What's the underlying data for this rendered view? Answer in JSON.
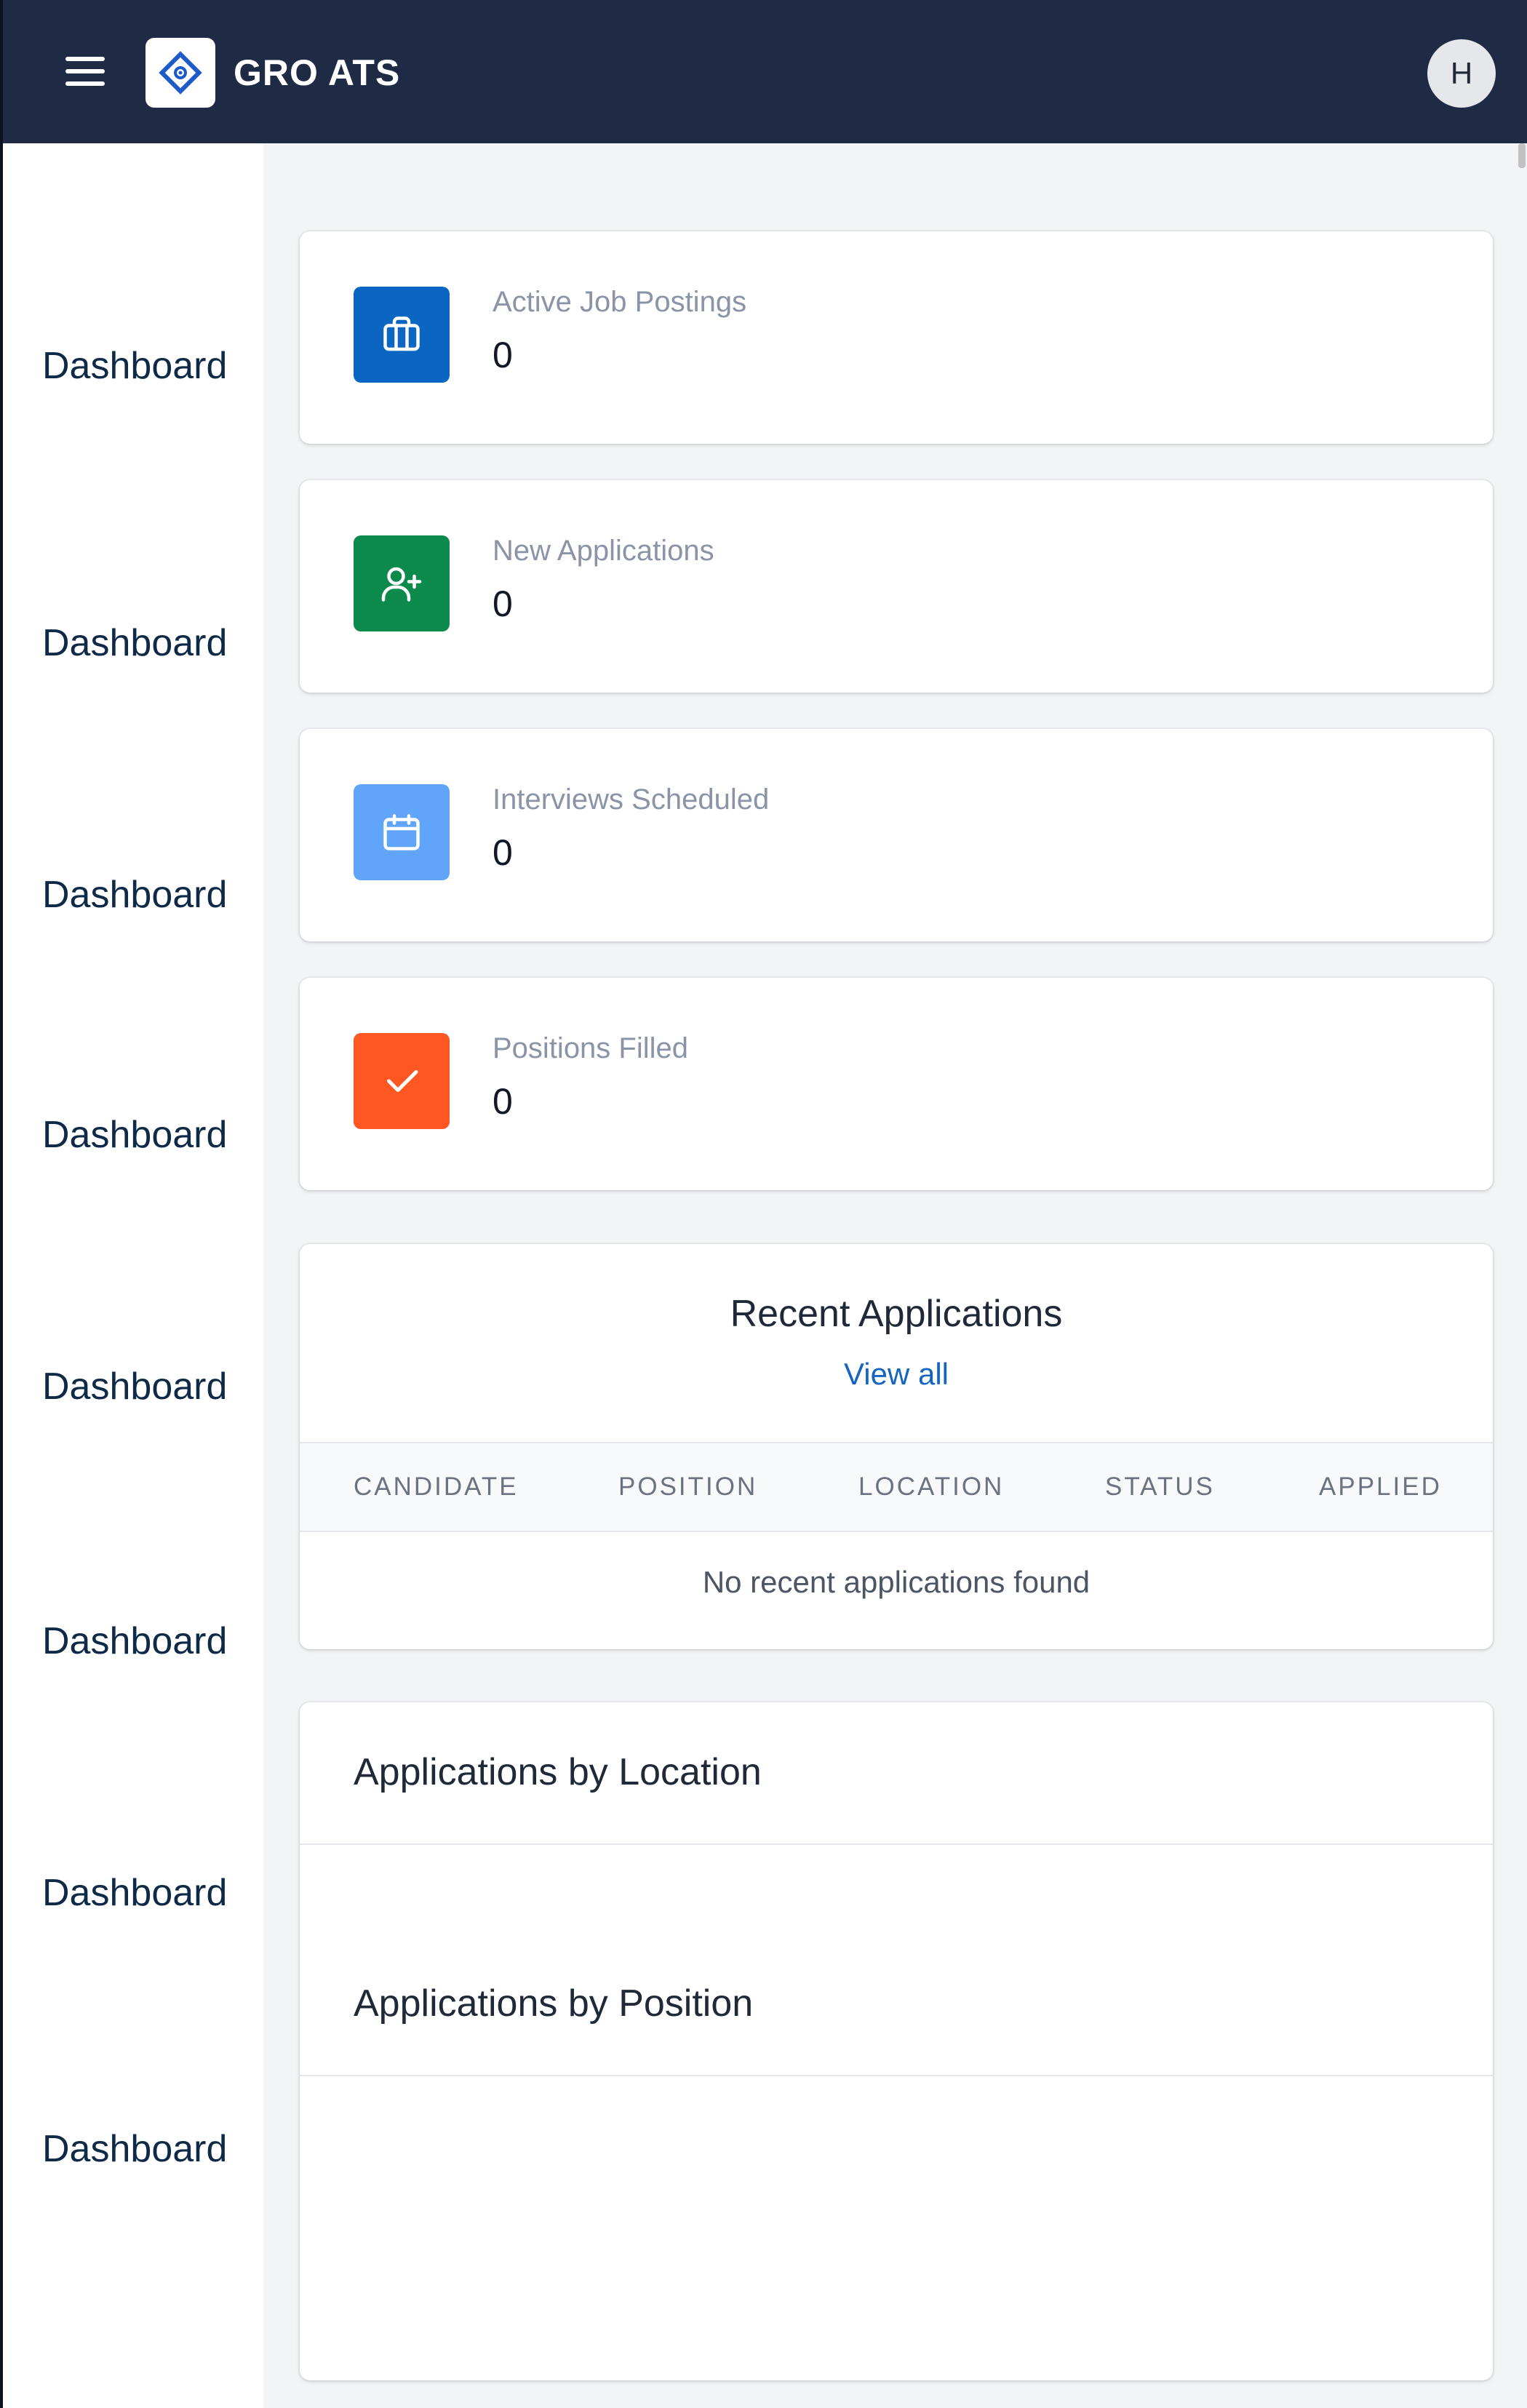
{
  "header": {
    "app_title": "GRO ATS",
    "avatar_initial": "H"
  },
  "sidebar": {
    "items": [
      {
        "label": "Dashboard"
      },
      {
        "label": "Dashboard"
      },
      {
        "label": "Dashboard"
      },
      {
        "label": "Dashboard"
      },
      {
        "label": "Dashboard"
      },
      {
        "label": "Dashboard"
      },
      {
        "label": "Dashboard"
      },
      {
        "label": "Dashboard"
      }
    ]
  },
  "stats": [
    {
      "label": "Active Job Postings",
      "value": "0",
      "icon": "briefcase-icon",
      "color": "#0a66c2"
    },
    {
      "label": "New Applications",
      "value": "0",
      "icon": "user-plus-icon",
      "color": "#0b8a4b"
    },
    {
      "label": "Interviews Scheduled",
      "value": "0",
      "icon": "calendar-icon",
      "color": "#60a5fa"
    },
    {
      "label": "Positions Filled",
      "value": "0",
      "icon": "check-icon",
      "color": "#ff5722"
    }
  ],
  "recent_applications": {
    "title": "Recent Applications",
    "view_all": "View all",
    "columns": [
      "CANDIDATE",
      "POSITION",
      "LOCATION",
      "STATUS",
      "APPLIED"
    ],
    "empty_message": "No recent applications found"
  },
  "charts": {
    "by_location_title": "Applications by Location",
    "by_position_title": "Applications by Position"
  }
}
